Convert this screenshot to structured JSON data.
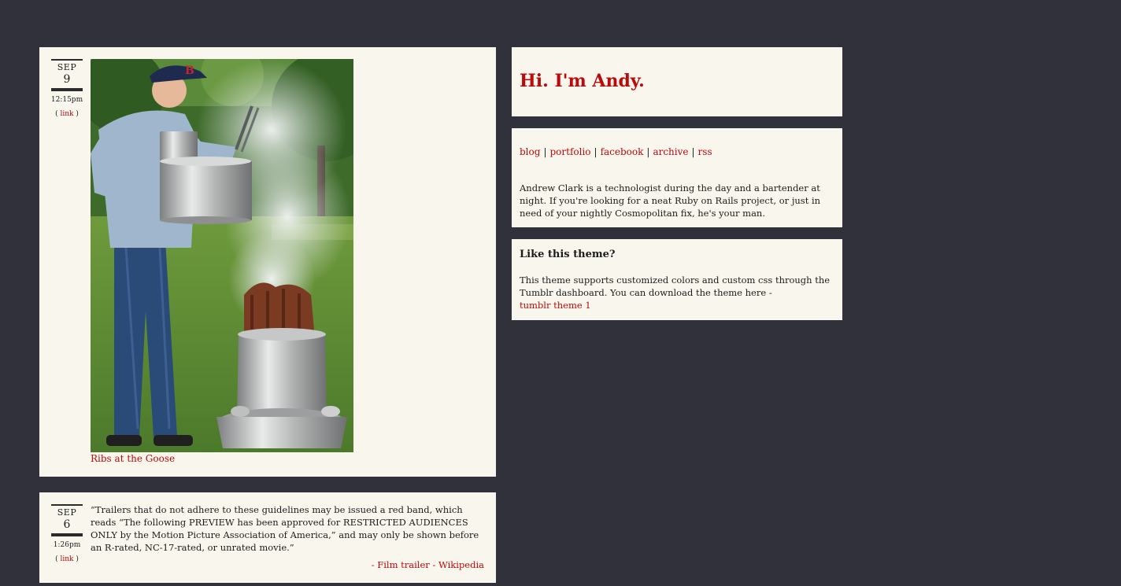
{
  "posts": {
    "photo_post": {
      "month": "SEP",
      "day": "9",
      "time": "12:15pm",
      "link_open": "( ",
      "link_label": "link",
      "link_close": " )",
      "caption": "Ribs at the Goose"
    },
    "quote_post": {
      "month": "SEP",
      "day": "6",
      "time": "1:26pm",
      "link_open": "( ",
      "link_label": "link",
      "link_close": " )",
      "quote": "“Trailers that do not adhere to these guidelines may be issued a red band, which reads “The following PREVIEW has been approved for RESTRICTED AUDIENCES ONLY by the Motion Picture Association of America,” and may only be shown before an R-rated, NC-17-rated, or unrated movie.”",
      "source": "- Film trailer - Wikipedia"
    }
  },
  "sidebar": {
    "title": "Hi. I'm Andy.",
    "nav": {
      "items": [
        "blog",
        "portfolio",
        "facebook",
        "archive",
        "rss"
      ],
      "separator": "|"
    },
    "about": "Andrew Clark is a technologist during the day and a bartender at night. If you're looking for a neat Ruby on Rails project, or just in need of your nightly Cosmopolitan fix, he's your man.",
    "theme": {
      "heading": "Like this theme?",
      "text": "This theme supports customized colors and custom css through the Tumblr dashboard. You can download the theme here -",
      "link_label": "tumblr theme 1"
    }
  },
  "colors": {
    "background": "#31313b",
    "panel": "#f8f6ed",
    "accent": "#bb0a0a",
    "text": "#1c1c1c"
  }
}
